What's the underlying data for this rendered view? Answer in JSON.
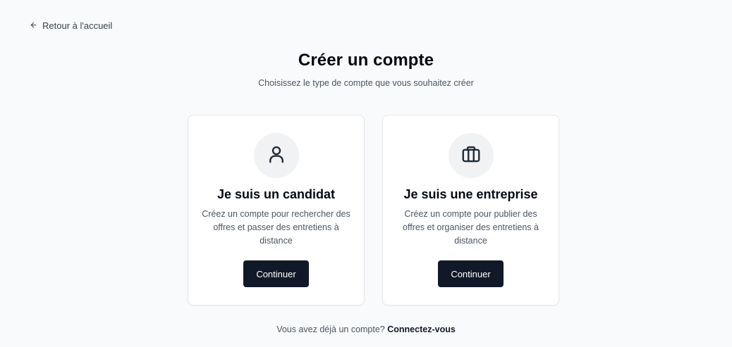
{
  "nav": {
    "back_label": "Retour à l'accueil",
    "back_icon": "arrow-left-icon"
  },
  "header": {
    "title": "Créer un compte",
    "subtitle": "Choisissez le type de compte que vous souhaitez créer"
  },
  "cards": [
    {
      "icon": "user-icon",
      "title": "Je suis un candidat",
      "description": "Créez un compte pour rechercher des offres et passer des entretiens à distance",
      "button_label": "Continuer"
    },
    {
      "icon": "briefcase-icon",
      "title": "Je suis une entreprise",
      "description": "Créez un compte pour publier des offres et organiser des entretiens à distance",
      "button_label": "Continuer"
    }
  ],
  "footer": {
    "prompt": "Vous avez déjà un compte?",
    "login_label": "Connectez-vous"
  },
  "colors": {
    "background": "#f9fafb",
    "button": "#111827",
    "icon_circle": "#f1f2f4"
  }
}
